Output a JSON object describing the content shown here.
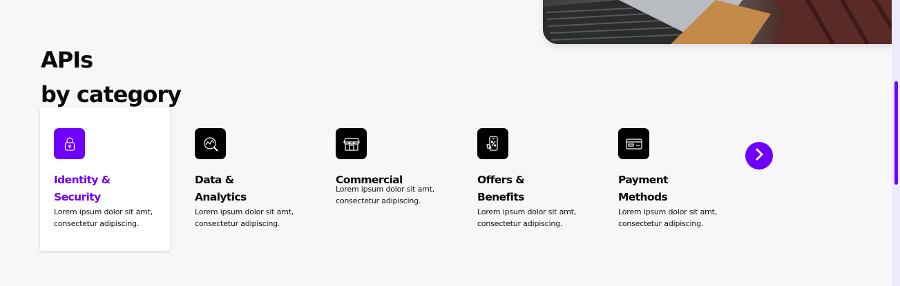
{
  "section": {
    "title_line1": "APIs",
    "title_line2": "by category"
  },
  "categories": [
    {
      "title_line1": "Identity &",
      "title_line2": "Security",
      "description": "Lorem ipsum dolor sit amt, consectetur adipiscing.",
      "icon": "lock-icon",
      "active": true
    },
    {
      "title_line1": "Data &",
      "title_line2": "Analytics",
      "description": "Lorem ipsum dolor sit amt, consectetur adipiscing.",
      "icon": "analytics-icon",
      "active": false
    },
    {
      "title_line1": "Commercial",
      "title_line2": "",
      "description": "Lorem ipsum dolor sit amt, consectetur adipiscing.",
      "icon": "storefront-icon",
      "active": false
    },
    {
      "title_line1": "Offers &",
      "title_line2": "Benefits",
      "description": "Lorem ipsum dolor sit amt, consectetur adipiscing.",
      "icon": "mobile-offer-icon",
      "active": false
    },
    {
      "title_line1": "Payment",
      "title_line2": "Methods",
      "description": "Lorem ipsum dolor sit amt, consectetur adipiscing.",
      "icon": "credit-card-icon",
      "active": false
    }
  ],
  "navigation": {
    "next_icon": "chevron-right-icon"
  },
  "colors": {
    "accent": "#6f00ff",
    "background": "#f7f6f9",
    "icon_tile": "#000000",
    "text": "#0a0a0a"
  }
}
